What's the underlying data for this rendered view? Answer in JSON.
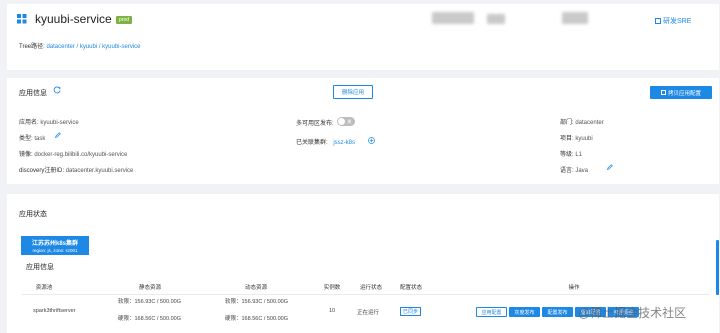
{
  "header": {
    "app_name": "kyuubi-service",
    "env_badge": "prod",
    "tree_label": "Tree路径:",
    "tree_path": "datacenter / kyuubi / kyuubi-service",
    "sre_link": "研发SRE"
  },
  "app_info": {
    "title": "应用信息",
    "delete_button": "删除应用",
    "copy_button": "拷贝应用配置",
    "fields": {
      "app_name_label": "应用名:",
      "app_name_value": "kyuubi-service",
      "type_label": "类型:",
      "type_value": "task",
      "image_label": "镜像:",
      "image_value": "docker-reg.bilibili.co/kyuubi-service",
      "discovery_label": "discovery注册ID:",
      "discovery_value": "datacenter.kyuubi.service",
      "multi_zone_label": "多可用区发布:",
      "multi_zone_toggle": "关",
      "clusters_label": "已关联集群:",
      "clusters_value": "jssz-k8s",
      "dept_label": "部门:",
      "dept_value": "datacenter",
      "project_label": "项目:",
      "project_value": "kyuubi",
      "level_label": "等级:",
      "level_value": "L1",
      "language_label": "语言:",
      "language_value": "Java"
    }
  },
  "app_status": {
    "title": "应用状态",
    "cluster_tab": {
      "name": "江苏苏州k8s集群",
      "detail": "region: js, zone: sz001"
    },
    "subtitle": "应用信息",
    "columns": [
      "资源池",
      "静态资源",
      "动态资源",
      "实例数",
      "运行状态",
      "配置状态",
      "操作"
    ],
    "rows": [
      {
        "pool": "spark3thriftserver",
        "static_soft": "软限：156.93C / 500.00G",
        "static_hard": "硬限：168.56C / 500.00G",
        "dynamic_soft": "软限：156.93C / 500.00G",
        "dynamic_hard": "硬限：168.56C / 500.00G",
        "instances": "10",
        "run_status": "正在运行",
        "config_status": "已同步",
        "actions": [
          "应用配置",
          "灰度发布",
          "配置发布",
          "重启配置",
          "资源调整"
        ]
      }
    ]
  },
  "watermark": "@稀土掘金技术社区",
  "colors": {
    "accent": "#1e88e5",
    "badge": "#7cb342"
  }
}
